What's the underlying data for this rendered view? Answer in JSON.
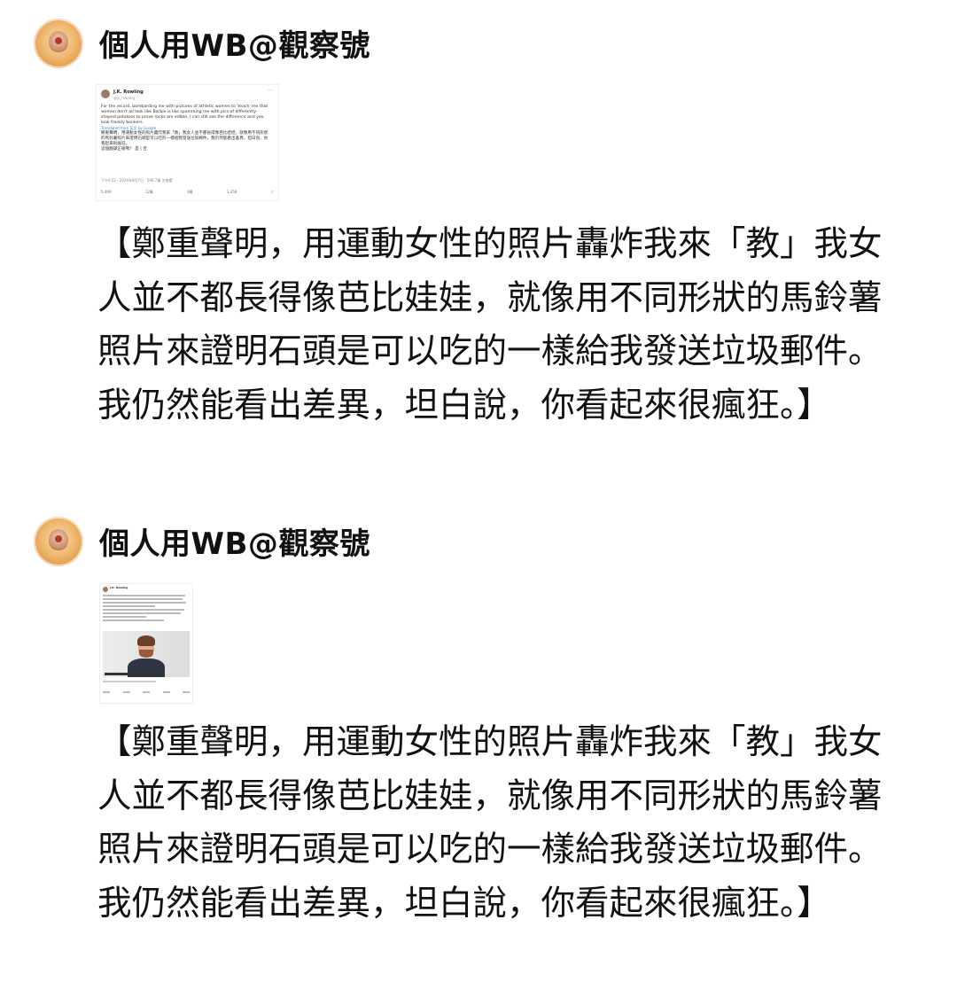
{
  "posts": [
    {
      "username": "個人用WB@觀察號",
      "text": "【鄭重聲明，用運動女性的照片轟炸我來「教」我女人並不都長得像芭比娃娃，就像用不同形狀的馬鈴薯照片來證明石頭是可以吃的一樣給我發送垃圾郵件。我仍然能看出差異，坦白說，你看起來很瘋狂。】",
      "embedded_tweet": {
        "author": "J.K. Rowling",
        "handle": "@jk_rowling",
        "body_en": "For the record, bombarding me with pictures of athletic women to 'teach' me that women don't all look like Barbie is like spamming me with pics of differently-shaped potatoes to prove rocks are edible. I can still see the difference and you look frankly bonkers.",
        "translate_label": "Translated from 英文 by Google",
        "body_translated": "鄭重聲明，用運動女性的照片轟炸我來「教」我女人並不都長得像芭比娃娃，就像用不同形狀的馬鈴薯照片來證明石頭是可以吃的一樣給我發送垃圾郵件。我仍然能看出差異，坦白說，你看起來很瘋狂。",
        "rating_line": "這個翻譯正確嗎？ 是 | 否",
        "meta": "下午6:52 · 2024年8月7日 · 596.7萬 次查看",
        "actions": [
          "5,469",
          "12萬",
          "9萬",
          "3,358",
          ""
        ]
      }
    },
    {
      "username": "個人用WB@觀察號",
      "text": "【鄭重聲明，用運動女性的照片轟炸我來「教」我女人並不都長得像芭比娃娃，就像用不同形狀的馬鈴薯照片來證明石頭是可以吃的一樣給我發送垃圾郵件。我仍然能看出差異，坦白說，你看起來很瘋狂。】",
      "embedded_tweet": {
        "author": "J.K. Rowling"
      }
    }
  ]
}
